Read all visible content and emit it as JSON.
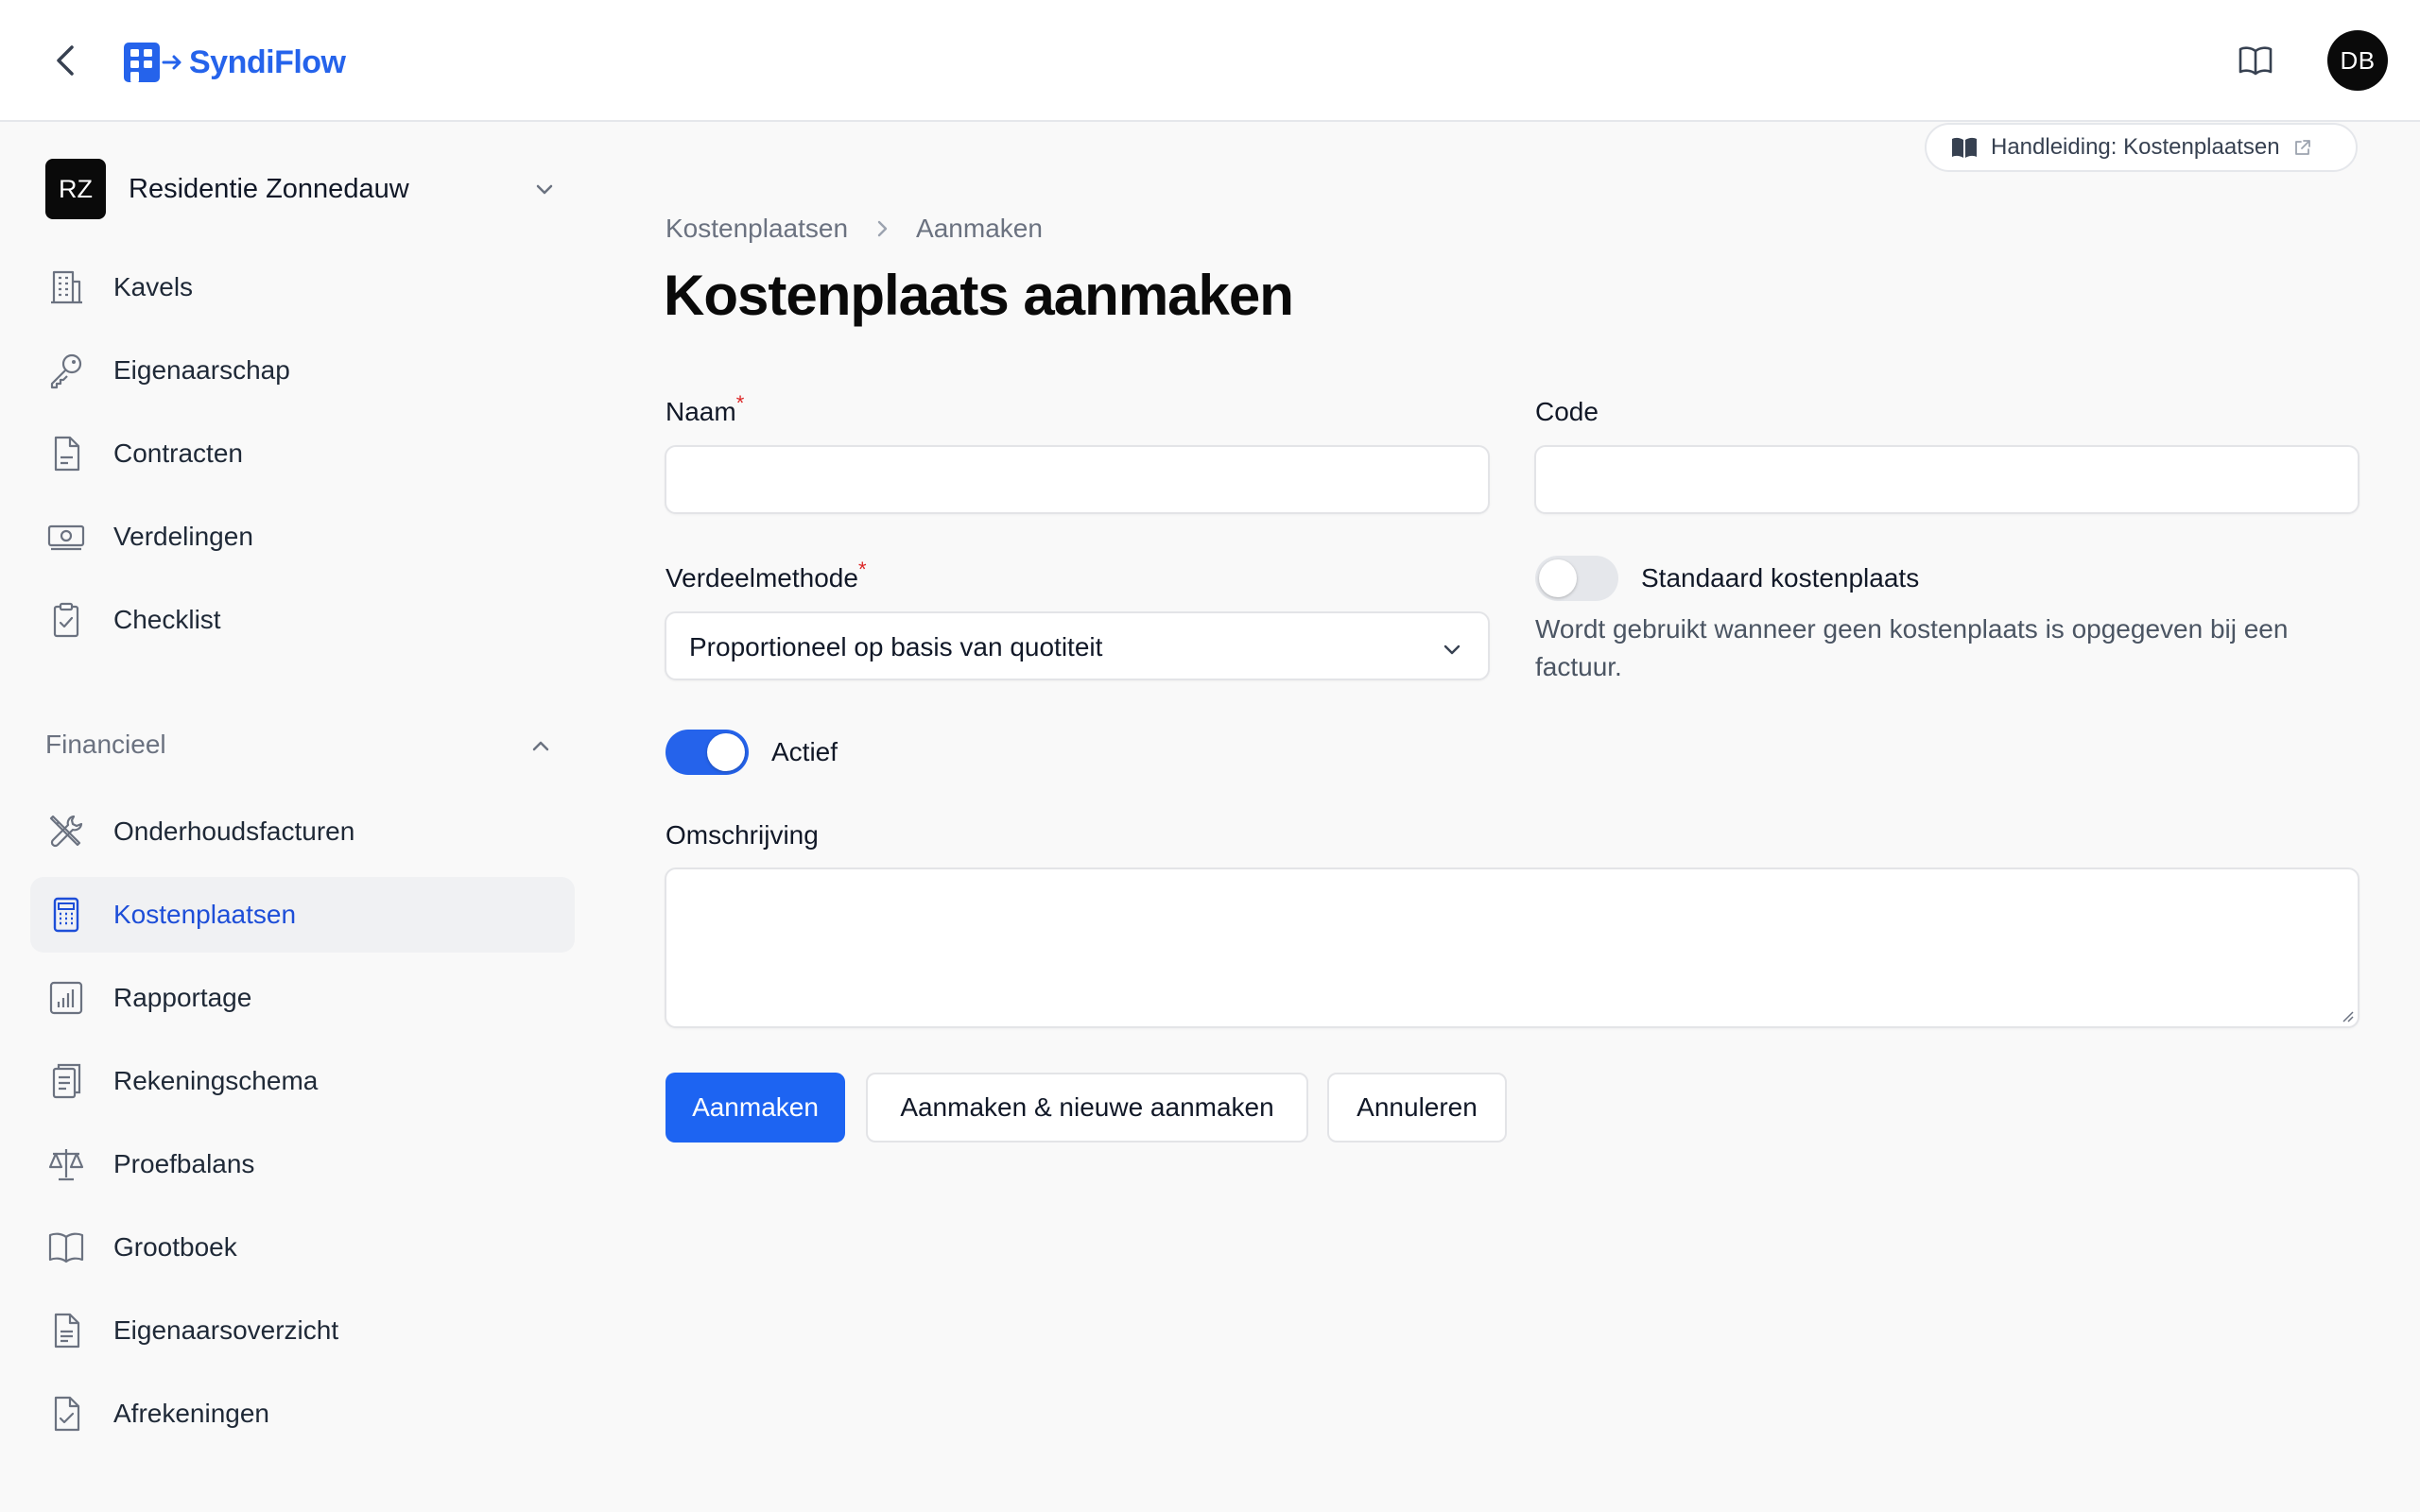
{
  "app": {
    "name": "SyndiFlow",
    "user_initials": "DB"
  },
  "sidebar": {
    "tenant": {
      "initials": "RZ",
      "name": "Residentie Zonnedauw"
    },
    "items": [
      {
        "label": "Kavels",
        "icon": "building-icon"
      },
      {
        "label": "Eigenaarschap",
        "icon": "key-icon"
      },
      {
        "label": "Contracten",
        "icon": "document-icon"
      },
      {
        "label": "Verdelingen",
        "icon": "banknote-icon"
      },
      {
        "label": "Checklist",
        "icon": "clipboard-check-icon"
      }
    ],
    "section_label": "Financieel",
    "finance_items": [
      {
        "label": "Onderhoudsfacturen",
        "icon": "wrench-screwdriver-icon"
      },
      {
        "label": "Kostenplaatsen",
        "icon": "calculator-icon",
        "active": true
      },
      {
        "label": "Rapportage",
        "icon": "chart-bar-icon"
      },
      {
        "label": "Rekeningschema",
        "icon": "clipboard-list-icon"
      },
      {
        "label": "Proefbalans",
        "icon": "scale-icon"
      },
      {
        "label": "Grootboek",
        "icon": "book-open-icon"
      },
      {
        "label": "Eigenaarsoverzicht",
        "icon": "document-text-icon"
      },
      {
        "label": "Afrekeningen",
        "icon": "document-check-icon"
      }
    ]
  },
  "main": {
    "manual_link": "Handleiding: Kostenplaatsen",
    "breadcrumb": [
      "Kostenplaatsen",
      "Aanmaken"
    ],
    "title": "Kostenplaats aanmaken",
    "form": {
      "naam_label": "Naam",
      "naam_required": "*",
      "naam_value": "",
      "code_label": "Code",
      "code_value": "",
      "verdeelmethode_label": "Verdeelmethode",
      "verdeelmethode_required": "*",
      "verdeelmethode_value": "Proportioneel op basis van quotiteit",
      "standaard_label": "Standaard kostenplaats",
      "standaard_on": false,
      "standaard_help": "Wordt gebruikt wanneer geen kostenplaats is opgegeven bij een factuur.",
      "actief_label": "Actief",
      "actief_on": true,
      "omschrijving_label": "Omschrijving",
      "omschrijving_value": ""
    },
    "buttons": {
      "create": "Aanmaken",
      "create_another": "Aanmaken & nieuwe aanmaken",
      "cancel": "Annuleren"
    }
  },
  "colors": {
    "accent": "#1d64f2",
    "active_nav_text": "#1d4ed8",
    "required": "#dc2626"
  }
}
